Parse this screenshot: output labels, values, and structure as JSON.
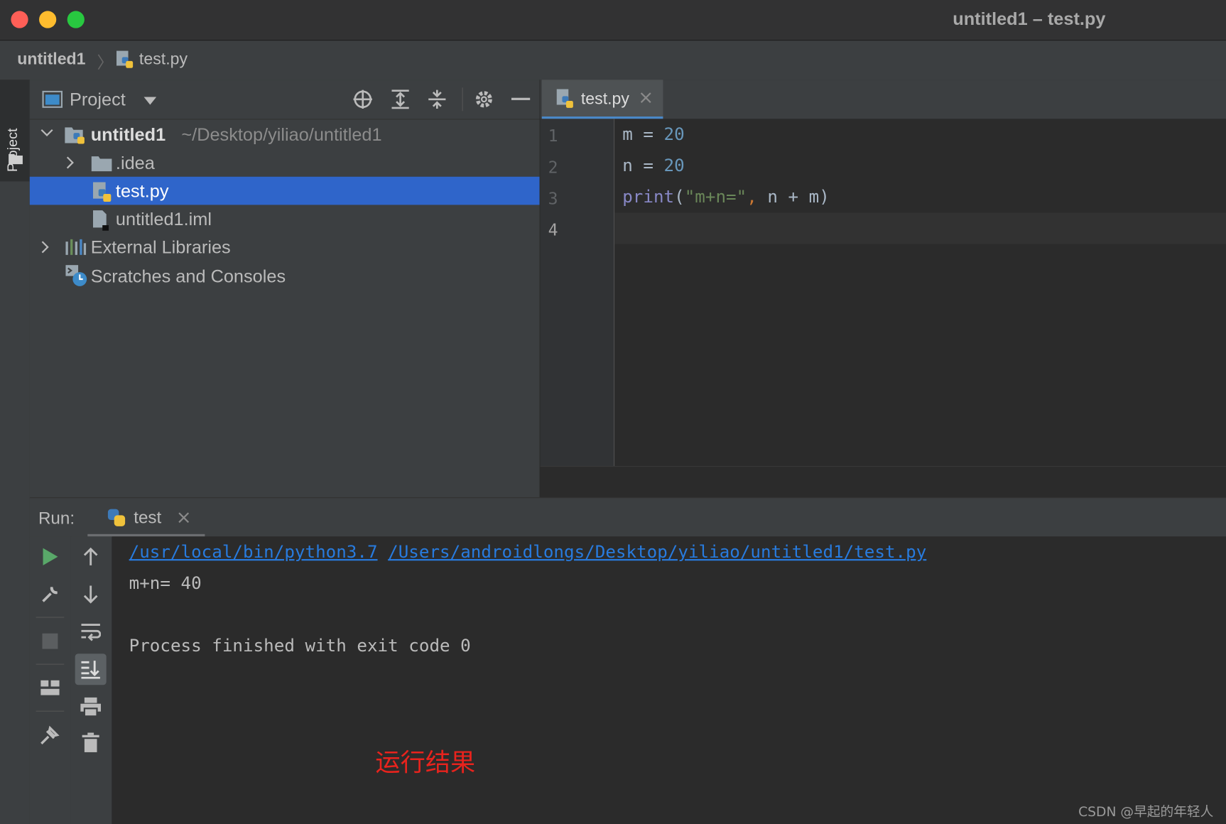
{
  "window": {
    "title": "untitled1 – test.py",
    "traffic_lights": [
      "#ff5f57",
      "#febc2e",
      "#28c840"
    ]
  },
  "breadcrumb": {
    "project": "untitled1",
    "file": "test.py"
  },
  "left_stripe": {
    "label": "Project"
  },
  "project_panel": {
    "title": "Project",
    "tree": {
      "root_name": "untitled1",
      "root_path": "~/Desktop/yiliao/untitled1",
      "items": [
        {
          "label": ".idea",
          "icon": "folder-icon"
        },
        {
          "label": "test.py",
          "icon": "python-file-icon",
          "selected": true
        },
        {
          "label": "untitled1.iml",
          "icon": "iml-file-icon"
        },
        {
          "label": "External Libraries",
          "icon": "library-icon"
        },
        {
          "label": "Scratches and Consoles",
          "icon": "scratches-icon"
        }
      ]
    }
  },
  "editor": {
    "tab_label": "test.py",
    "line_numbers": [
      "1",
      "2",
      "3",
      "4"
    ],
    "lines": [
      {
        "var": "m",
        "op": " = ",
        "num": "20"
      },
      {
        "var": "n",
        "op": " = ",
        "num": "20"
      },
      {
        "fn": "print",
        "open": "(",
        "str": "\"m+n=\"",
        "comma": ",",
        "rest": " n + m)"
      }
    ]
  },
  "run": {
    "label": "Run:",
    "tab_label": "test",
    "command_interpreter": "/usr/local/bin/python3.7",
    "command_script": "/Users/androidlongs/Desktop/yiliao/untitled1/test.py",
    "output": "m+n= 40",
    "exit_message": "Process finished with exit code 0",
    "annotation": "运行结果",
    "annotation_color": "#e8231d"
  },
  "watermark": "CSDN @早起的年轻人",
  "colors": {
    "selection": "#2f65ca",
    "number": "#6897bb",
    "string": "#6a8759",
    "function": "#8888c6",
    "comma": "#cc7832",
    "link": "#287bde"
  }
}
